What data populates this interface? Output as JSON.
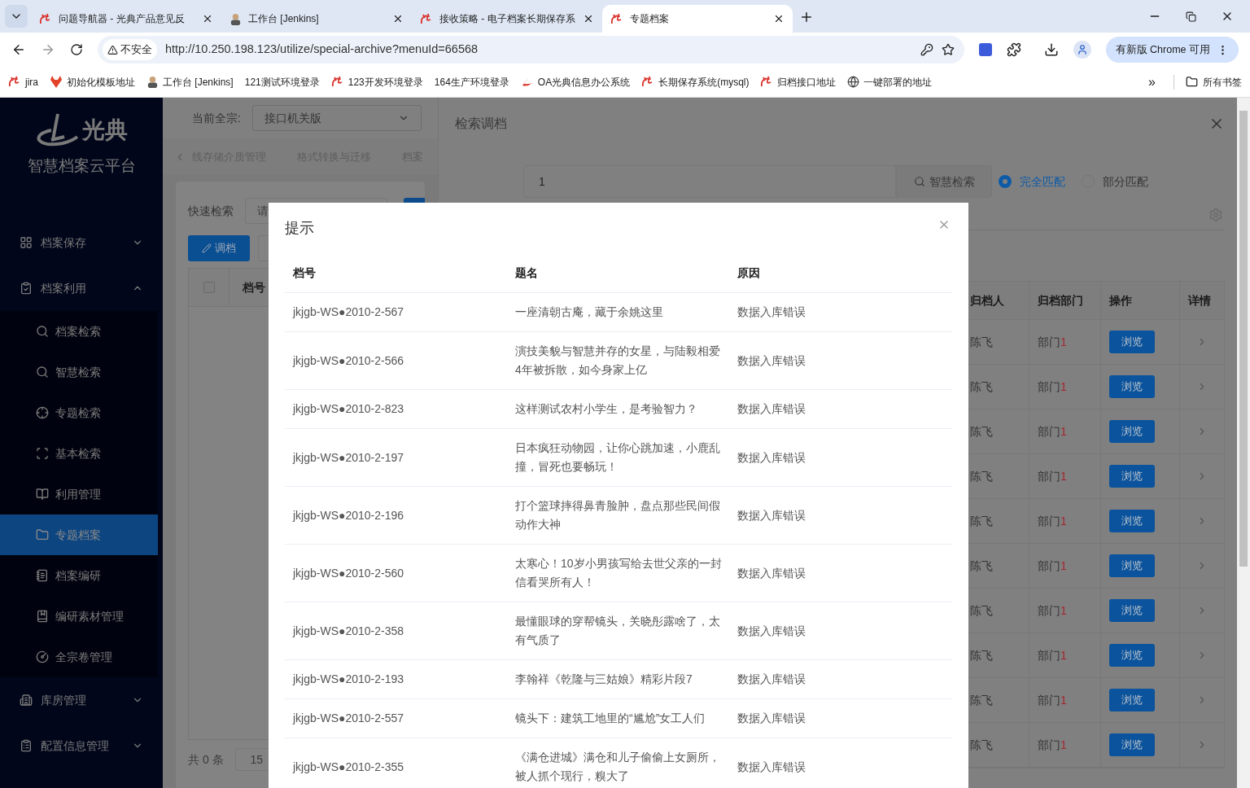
{
  "browser": {
    "tabs": [
      {
        "title": "问题导航器 - 光典产品意见反",
        "selected": false
      },
      {
        "title": "工作台 [Jenkins]",
        "selected": false
      },
      {
        "title": "接收策略 - 电子档案长期保存系",
        "selected": false
      },
      {
        "title": "专题档案",
        "selected": true
      }
    ],
    "security": "不安全",
    "url": "http://10.250.198.123/utilize/special-archive?menuId=66568",
    "update_button": "有新版 Chrome 可用",
    "bookmarks": [
      "jira",
      "初始化模板地址",
      "工作台 [Jenkins]",
      "121测试环境登录",
      "123开发环境登录",
      "164生产环境登录",
      "OA光典信息办公系统",
      "长期保存系统(mysql)",
      "归档接口地址",
      "一键部署的地址"
    ],
    "overflow": "»",
    "all_bookmarks": "所有书签"
  },
  "sidebar": {
    "logo_text": "光典",
    "platform": "智慧档案云平台",
    "items": [
      {
        "label": "档案保存",
        "expanded": false
      },
      {
        "label": "档案利用",
        "expanded": true,
        "children": [
          {
            "label": "档案检索",
            "selected": false
          },
          {
            "label": "智慧检索",
            "selected": false
          },
          {
            "label": "专题检索",
            "selected": false
          },
          {
            "label": "基本检索",
            "selected": false
          },
          {
            "label": "利用管理",
            "selected": false
          },
          {
            "label": "专题档案",
            "selected": true
          },
          {
            "label": "档案编研",
            "selected": false
          },
          {
            "label": "编研素材管理",
            "selected": false
          },
          {
            "label": "全宗卷管理",
            "selected": false
          }
        ]
      },
      {
        "label": "库房管理",
        "expanded": false
      },
      {
        "label": "配置信息管理",
        "expanded": false
      }
    ]
  },
  "page": {
    "fonds_label": "当前全宗:",
    "fonds_value": "接口机关版",
    "tabs": [
      "线存储介质管理",
      "格式转换与迁移",
      "档案"
    ],
    "quick_search_label": "快速检索",
    "quick_search_placeholder": "请",
    "adjust_button": "调档",
    "select_all_checked": false,
    "table_columns": [
      "档号"
    ],
    "total": "共 0 条",
    "page_size": "15"
  },
  "drawer": {
    "title": "检索调档",
    "search_value": "1",
    "search_button": "智慧检索",
    "match_options": [
      {
        "label": "完全匹配",
        "selected": true
      },
      {
        "label": "部分匹配",
        "selected": false
      }
    ],
    "columns": [
      "归档人",
      "归档部门",
      "操作",
      "详情"
    ],
    "rows": [
      {
        "archiver": "陈飞",
        "department": "部门",
        "department_number": "1",
        "action": "浏览"
      },
      {
        "archiver": "陈飞",
        "department": "部门",
        "department_number": "1",
        "action": "浏览"
      },
      {
        "archiver": "陈飞",
        "department": "部门",
        "department_number": "1",
        "action": "浏览"
      },
      {
        "archiver": "陈飞",
        "department": "部门",
        "department_number": "1",
        "action": "浏览"
      },
      {
        "archiver": "陈飞",
        "department": "部门",
        "department_number": "1",
        "action": "浏览"
      },
      {
        "archiver": "陈飞",
        "department": "部门",
        "department_number": "1",
        "action": "浏览"
      },
      {
        "archiver": "陈飞",
        "department": "部门",
        "department_number": "1",
        "action": "浏览"
      },
      {
        "archiver": "陈飞",
        "department": "部门",
        "department_number": "1",
        "action": "浏览"
      },
      {
        "archiver": "陈飞",
        "department": "部门",
        "department_number": "1",
        "action": "浏览"
      },
      {
        "archiver": "陈飞",
        "department": "部门",
        "department_number": "1",
        "action": "浏览"
      }
    ]
  },
  "dialog": {
    "title": "提示",
    "columns": [
      "档号",
      "题名",
      "原因"
    ],
    "rows": [
      {
        "archive_no": "jkjgb-WS●2010-2-567",
        "title": "一座清朝古庵，藏于余姚这里",
        "reason": "数据入库错误"
      },
      {
        "archive_no": "jkjgb-WS●2010-2-566",
        "title": "演技美貌与智慧并存的女星，与陆毅相爱4年被拆散，如今身家上亿",
        "reason": "数据入库错误"
      },
      {
        "archive_no": "jkjgb-WS●2010-2-823",
        "title": "这样测试农村小学生，是考验智力？",
        "reason": "数据入库错误"
      },
      {
        "archive_no": "jkjgb-WS●2010-2-197",
        "title": "日本疯狂动物园，让你心跳加速，小鹿乱撞，冒死也要畅玩！",
        "reason": "数据入库错误"
      },
      {
        "archive_no": "jkjgb-WS●2010-2-196",
        "title": "打个篮球摔得鼻青脸肿，盘点那些民间假动作大神",
        "reason": "数据入库错误"
      },
      {
        "archive_no": "jkjgb-WS●2010-2-560",
        "title": "太寒心！10岁小男孩写给去世父亲的一封信看哭所有人！",
        "reason": "数据入库错误"
      },
      {
        "archive_no": "jkjgb-WS●2010-2-358",
        "title": "最懂眼球的穿帮镜头，关晓彤露啥了，太有气质了",
        "reason": "数据入库错误"
      },
      {
        "archive_no": "jkjgb-WS●2010-2-193",
        "title": "李翰祥《乾隆与三姑娘》精彩片段7",
        "reason": "数据入库错误"
      },
      {
        "archive_no": "jkjgb-WS●2010-2-557",
        "title": "镜头下：建筑工地里的“尴尬”女工人们",
        "reason": "数据入库错误"
      },
      {
        "archive_no": "jkjgb-WS●2010-2-355",
        "title": "《满仓进城》满仓和儿子偷偷上女厕所，被人抓个现行，糗大了",
        "reason": "数据入库错误"
      }
    ]
  }
}
